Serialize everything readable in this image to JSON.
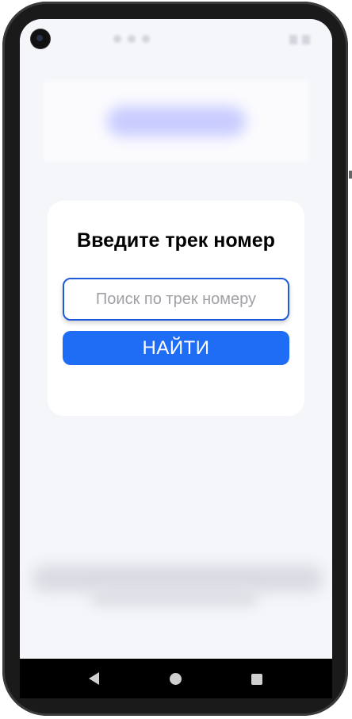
{
  "card": {
    "title": "Введите трек номер",
    "search_placeholder": "Поиск по трек номеру",
    "search_value": "",
    "find_button_label": "НАЙТИ"
  },
  "colors": {
    "accent": "#1f6df5",
    "input_border": "#1e5bd8",
    "screen_background": "#f5f6fa",
    "card_background": "#ffffff"
  },
  "navigation": {
    "icons": [
      "back-icon",
      "home-icon",
      "recents-icon"
    ]
  }
}
